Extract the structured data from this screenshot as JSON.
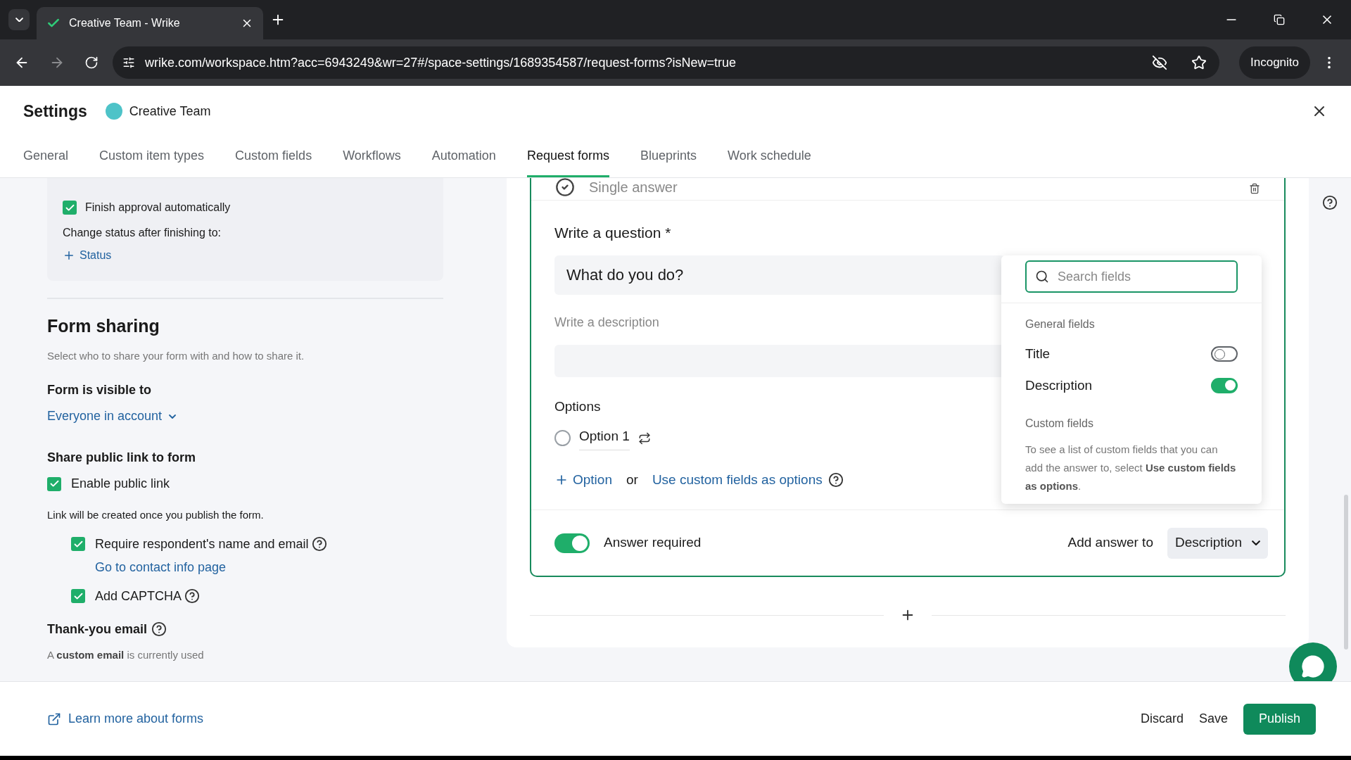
{
  "browser": {
    "tab_title": "Creative Team - Wrike",
    "url": "wrike.com/workspace.htm?acc=6943249&wr=27#/space-settings/1689354587/request-forms?isNew=true",
    "incognito_label": "Incognito"
  },
  "settings": {
    "title": "Settings",
    "space_name": "Creative Team",
    "tabs": [
      {
        "label": "General",
        "selected": false
      },
      {
        "label": "Custom item types",
        "selected": false
      },
      {
        "label": "Custom fields",
        "selected": false
      },
      {
        "label": "Workflows",
        "selected": false
      },
      {
        "label": "Automation",
        "selected": false
      },
      {
        "label": "Request forms",
        "selected": true
      },
      {
        "label": "Blueprints",
        "selected": false
      },
      {
        "label": "Work schedule",
        "selected": false
      }
    ]
  },
  "approval": {
    "finish_auto": {
      "label": "Finish approval automatically",
      "checked": true
    },
    "change_status_label": "Change status after finishing to:",
    "status_link": "Status"
  },
  "form_sharing": {
    "heading": "Form sharing",
    "subtitle": "Select who to share your form with and how to share it.",
    "visible_heading": "Form is visible to",
    "visible_value": "Everyone in account",
    "public_heading": "Share public link to form",
    "enable_public": {
      "label": "Enable public link",
      "checked": true
    },
    "link_note": "Link will be created once you publish the form.",
    "require_contact": {
      "label": "Require respondent's name and email",
      "checked": true
    },
    "contact_link": "Go to contact info page",
    "captcha": {
      "label": "Add CAPTCHA",
      "checked": true
    },
    "thankyou_heading": "Thank-you email",
    "thankyou_note": "A **custom email** is currently used"
  },
  "question": {
    "type_label": "Single answer",
    "question_label": "Write a question *",
    "question_value": "What do you do?",
    "description_placeholder": "Write a description",
    "options_label": "Options",
    "options": [
      {
        "label": "Option 1",
        "selected": false
      }
    ],
    "add_option": "Option",
    "or_text": "or",
    "custom_fields_link": "Use custom fields as options",
    "answer_required": {
      "label": "Answer required",
      "on": true
    },
    "add_answer_label": "Add answer to",
    "add_answer_value": "Description"
  },
  "fields_menu": {
    "search_placeholder": "Search fields",
    "general_heading": "General fields",
    "fields": [
      {
        "label": "Title",
        "on": false
      },
      {
        "label": "Description",
        "on": true
      }
    ],
    "custom_heading": "Custom fields",
    "custom_note": "To see a list of custom fields that you can add the answer to, select **Use custom fields as options**."
  },
  "footer": {
    "learn_link": "Learn more about forms",
    "buttons": [
      {
        "label": "Discard",
        "kind": "plain"
      },
      {
        "label": "Save",
        "kind": "plain"
      },
      {
        "label": "Publish",
        "kind": "primary"
      }
    ]
  }
}
